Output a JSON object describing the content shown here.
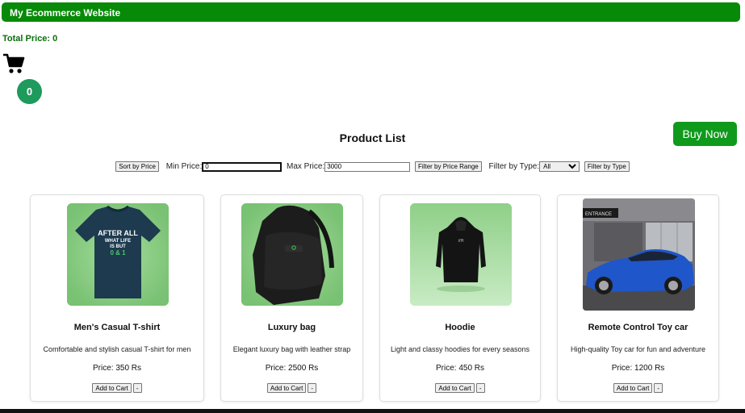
{
  "header": {
    "title": "My Ecommerce Website"
  },
  "cart": {
    "total_label": "Total Price: 0",
    "count": "0",
    "icon": "shopping-cart-icon"
  },
  "buy_now_label": "Buy Now",
  "product_list": {
    "title": "Product List",
    "sort_button": "Sort by Price",
    "min_price_label": "Min Price:",
    "min_price_value": "0",
    "max_price_label": "Max Price:",
    "max_price_value": "3000",
    "filter_price_button": "Filter by Price Range",
    "filter_type_label": "Filter by Type:",
    "type_selected": "All",
    "filter_type_button": "Filter by Type"
  },
  "products": [
    {
      "name": "Men's Casual T-shirt",
      "description": "Comfortable and stylish casual T-shirt for men",
      "price": "Price: 350 Rs",
      "add_label": "Add to Cart",
      "remove_label": "-",
      "image": "navy t-shirt on green background",
      "shirt_text_1": "AFTER ALL",
      "shirt_text_2": "WHAT LIFE",
      "shirt_text_3": "IS BUT",
      "shirt_text_4": "0 & 1"
    },
    {
      "name": "Luxury bag",
      "description": "Elegant luxury bag with leather strap",
      "price": "Price: 2500 Rs",
      "add_label": "Add to Cart",
      "remove_label": "-",
      "image": "black sling bag on green background"
    },
    {
      "name": "Hoodie",
      "description": "Light and classy hoodies for every seasons",
      "price": "Price: 450 Rs",
      "add_label": "Add to Cart",
      "remove_label": "-",
      "image": "black hoodie on green background"
    },
    {
      "name": "Remote Control Toy car",
      "description": "High-quality Toy car for fun and adventure",
      "price": "Price: 1200 Rs",
      "add_label": "Add to Cart",
      "remove_label": "-",
      "image": "blue sports car",
      "sign_text": "ENTRANCE"
    }
  ],
  "colors": {
    "header_bg": "#078a07",
    "buy_now_bg": "#0f9a1c",
    "badge_bg": "#1d9a5c",
    "total_text": "#0a6e0a"
  }
}
